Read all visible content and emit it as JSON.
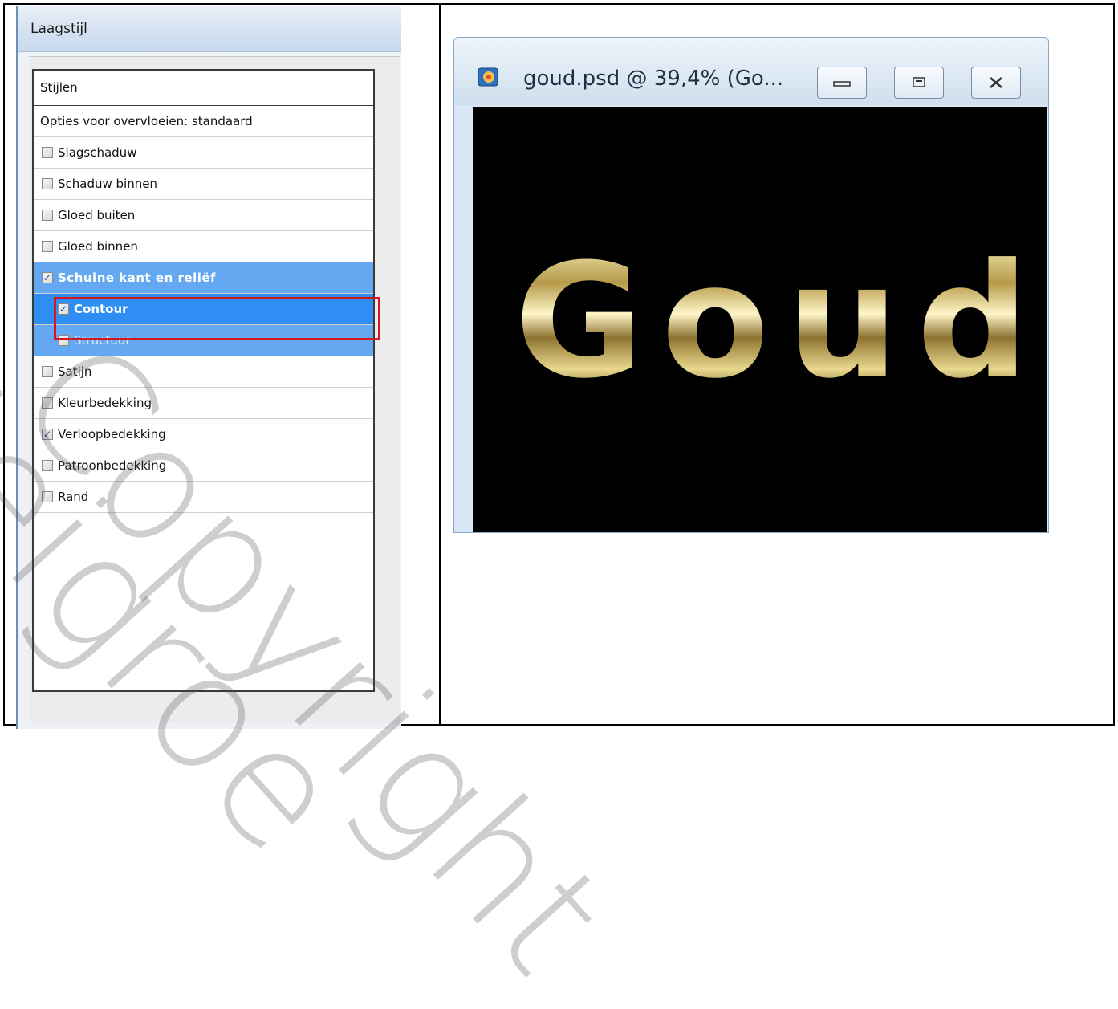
{
  "dialog": {
    "title": "Laagstijl",
    "panel_header": "Stijlen",
    "options_label": "Opties voor overvloeien: standaard",
    "items": [
      {
        "label": "Slagschaduw",
        "checked": false
      },
      {
        "label": "Schaduw binnen",
        "checked": false
      },
      {
        "label": "Gloed buiten",
        "checked": false
      },
      {
        "label": "Gloed binnen",
        "checked": false
      },
      {
        "label": "Schuine kant en reliëf",
        "checked": true
      },
      {
        "label": "Contour",
        "checked": true
      },
      {
        "label": "Structuur",
        "checked": false
      },
      {
        "label": "Satijn",
        "checked": false
      },
      {
        "label": "Kleurbedekking",
        "checked": false
      },
      {
        "label": "Verloopbedekking",
        "checked": true
      },
      {
        "label": "Patroonbedekking",
        "checked": false
      },
      {
        "label": "Rand",
        "checked": false
      }
    ]
  },
  "document_window": {
    "title": "goud.psd @ 39,4% (Go...",
    "canvas_text": "Goud",
    "buttons": [
      "minimize",
      "restore",
      "close"
    ]
  },
  "watermark": {
    "line1": "Copyright",
    "line2": "Meigroe"
  },
  "colors": {
    "selection_light": "#63a8f0",
    "selection_dark": "#2f8ef3",
    "highlight_border": "#d4161e",
    "canvas_bg": "#000000"
  }
}
